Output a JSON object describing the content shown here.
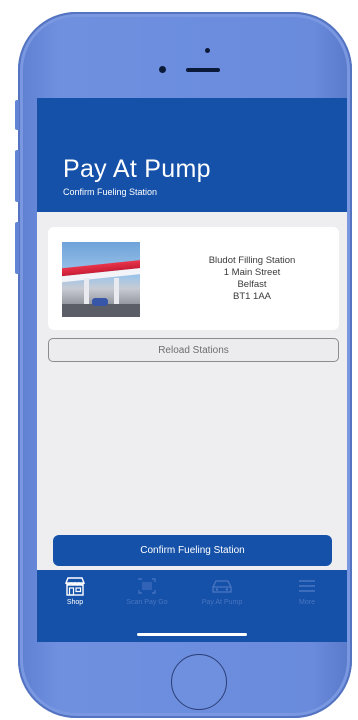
{
  "header": {
    "title": "Pay At Pump",
    "subtitle": "Confirm Fueling Station"
  },
  "station": {
    "name": "Bludot Filling Station",
    "street": "1 Main Street",
    "city": "Belfast",
    "postcode": "BT1 1AA"
  },
  "actions": {
    "reload_label": "Reload Stations",
    "confirm_label": "Confirm Fueling Station"
  },
  "tabbar": {
    "items": [
      {
        "label": "Shop",
        "icon": "shop-icon",
        "active": true
      },
      {
        "label": "Scan Pay Go",
        "icon": "barcode-icon",
        "active": false
      },
      {
        "label": "Pay At Pump",
        "icon": "car-icon",
        "active": false
      },
      {
        "label": "More",
        "icon": "menu-icon",
        "active": false
      }
    ]
  },
  "colors": {
    "brand_blue": "#1551a8",
    "phone_frame": "#6a8bdc",
    "background": "#eeeef0",
    "inactive_tab": "#4a75c2"
  }
}
